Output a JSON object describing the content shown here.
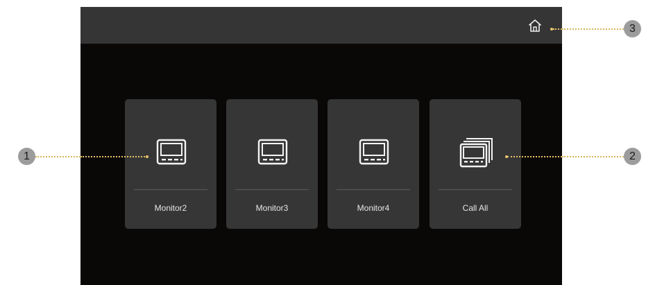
{
  "topbar": {
    "home_icon": "home-icon"
  },
  "tiles": [
    {
      "label": "Monitor2",
      "icon": "monitor-icon"
    },
    {
      "label": "Monitor3",
      "icon": "monitor-icon"
    },
    {
      "label": "Monitor4",
      "icon": "monitor-icon"
    },
    {
      "label": "Call All",
      "icon": "multi-monitor-icon"
    }
  ],
  "callouts": {
    "one": "1",
    "two": "2",
    "three": "3"
  },
  "colors": {
    "screen_bg": "#0a0707",
    "topbar_bg": "#353535",
    "tile_bg": "#363636",
    "tile_text": "#e6e6e6",
    "leader_line": "#e8c46a",
    "callout_bg": "#9c9c9c"
  }
}
